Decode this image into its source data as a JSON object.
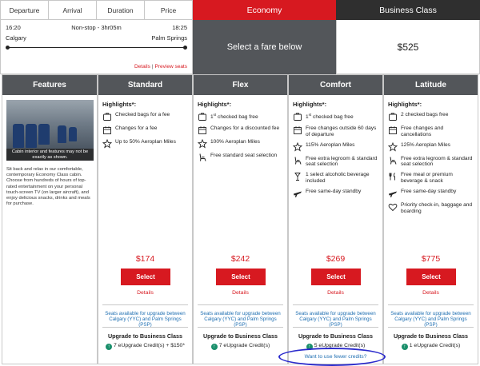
{
  "sort_tabs": [
    "Departure",
    "Arrival",
    "Duration",
    "Price"
  ],
  "cabins": {
    "economy": "Economy",
    "business": "Business Class"
  },
  "flight": {
    "depart_time": "16:20",
    "summary": "Non-stop - 3hr05m",
    "arrive_time": "18:25",
    "origin": "Calgary",
    "destination": "Palm Springs",
    "details_link": "Details",
    "preview_link": "Preview seats"
  },
  "select_fare_prompt": "Select a fare below",
  "business_price": "$525",
  "features": {
    "header": "Features",
    "photo_caption": "Cabin interior and features may not be exactly as shown.",
    "description": "Sit back and relax in our comfortable, contemporary Economy Class cabin. Choose from hundreds of hours of top-rated entertainment on your personal touch-screen TV (on larger aircraft), and enjoy delicious snacks, drinks and meals for purchase."
  },
  "highlights_label": "Highlights*:",
  "fares": [
    {
      "name": "Standard",
      "highlights": [
        {
          "icon": "baggage-icon",
          "text": "Checked bags for a fee"
        },
        {
          "icon": "calendar-icon",
          "text": "Changes for a fee"
        },
        {
          "icon": "star-icon",
          "text": "Up to 50% Aeroplan Miles"
        }
      ],
      "price": "$174",
      "select": "Select",
      "details": "Details",
      "availability": "Seats available for upgrade between Calgary (YYC) and Palm Springs (PSP)",
      "upgrade_title": "Upgrade to Business Class",
      "credits": "7 eUpgrade Credit(s) + $150*"
    },
    {
      "name": "Flex",
      "highlights": [
        {
          "icon": "baggage-icon",
          "text_pre": "1",
          "text_sup": "st",
          "text": " checked bag free"
        },
        {
          "icon": "calendar-icon",
          "text": "Changes for a discounted fee"
        },
        {
          "icon": "star-icon",
          "text": "100% Aeroplan Miles"
        },
        {
          "icon": "seat-icon",
          "text": "Free standard seat selection"
        }
      ],
      "price": "$242",
      "select": "Select",
      "details": "Details",
      "availability": "Seats available for upgrade between Calgary (YYC) and Palm Springs (PSP)",
      "upgrade_title": "Upgrade to Business Class",
      "credits": "7 eUpgrade Credit(s)"
    },
    {
      "name": "Comfort",
      "highlights": [
        {
          "icon": "baggage-icon",
          "text_pre": "1",
          "text_sup": "st",
          "text": " checked bag free"
        },
        {
          "icon": "calendar-icon",
          "text": "Free changes outside 60 days of departure"
        },
        {
          "icon": "star-icon",
          "text": "115% Aeroplan Miles"
        },
        {
          "icon": "seat-icon",
          "text": "Free extra legroom & standard seat selection"
        },
        {
          "icon": "glass-icon",
          "text": "1 select alcoholic beverage included"
        },
        {
          "icon": "plane-icon",
          "text": "Free same-day standby"
        }
      ],
      "price": "$269",
      "select": "Select",
      "details": "Details",
      "availability": "Seats available for upgrade between Calgary (YYC) and Palm Springs (PSP)",
      "upgrade_title": "Upgrade to Business Class",
      "credits": "5 eUpgrade Credit(s)",
      "fewer_credits_link": "Want to use fewer credits?"
    },
    {
      "name": "Latitude",
      "highlights": [
        {
          "icon": "baggage-icon",
          "text": "2 checked bags free"
        },
        {
          "icon": "calendar-icon",
          "text": "Free changes and cancellations"
        },
        {
          "icon": "star-icon",
          "text": "125% Aeroplan Miles"
        },
        {
          "icon": "seat-icon",
          "text": "Free extra legroom & standard seat selection"
        },
        {
          "icon": "cutlery-icon",
          "text": "Free meal or premium beverage & snack"
        },
        {
          "icon": "plane-icon",
          "text": "Free same-day standby"
        },
        {
          "icon": "heart-icon",
          "text": "Priority check-in, baggage and boarding"
        }
      ],
      "price": "$775",
      "select": "Select",
      "details": "Details",
      "availability": "Seats available for upgrade between Calgary (YYC) and Palm Springs (PSP)",
      "upgrade_title": "Upgrade to Business Class",
      "credits": "1 eUpgrade Credit(s)"
    }
  ],
  "colors": {
    "brand_red": "#d71920",
    "header_grey": "#53565a",
    "dark": "#2f2f2f",
    "link_blue": "#1f6fb2",
    "upgrade_green": "#1a8f6b"
  }
}
